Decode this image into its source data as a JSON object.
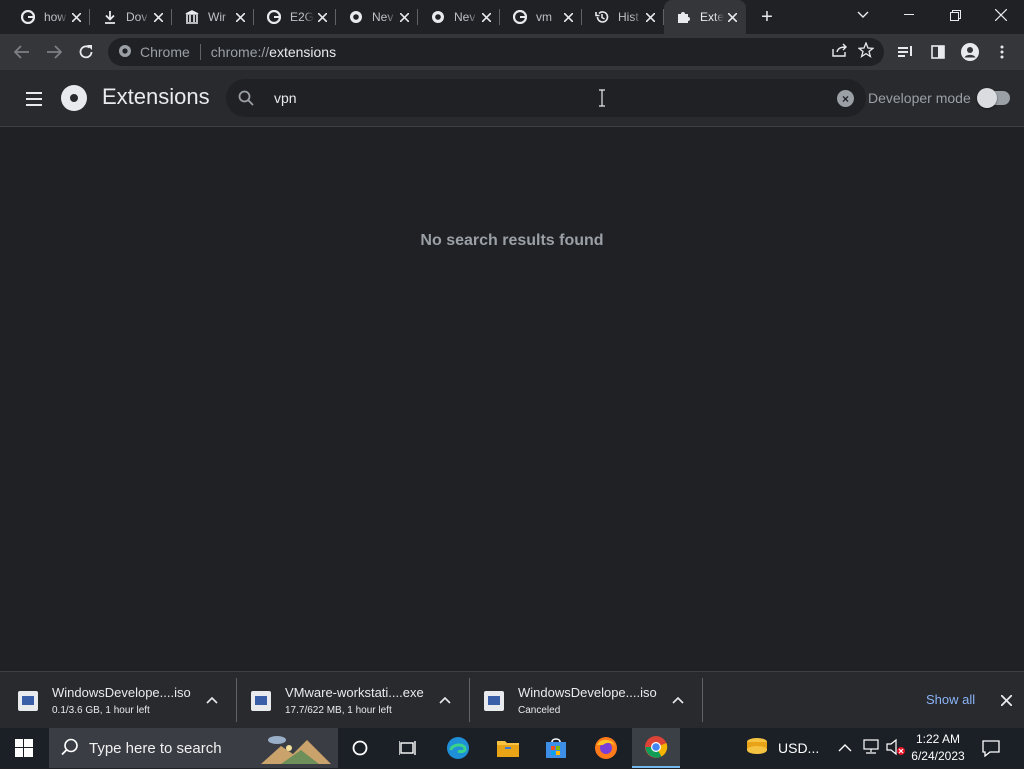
{
  "tabs": [
    {
      "title": "how",
      "icon": "google-icon",
      "active": false
    },
    {
      "title": "Dov",
      "icon": "download-icon",
      "active": false
    },
    {
      "title": "Wir",
      "icon": "museum-icon",
      "active": false
    },
    {
      "title": "E2G",
      "icon": "google-icon",
      "active": false
    },
    {
      "title": "Nev",
      "icon": "chrome-icon",
      "active": false
    },
    {
      "title": "Nev",
      "icon": "chrome-icon",
      "active": false
    },
    {
      "title": "vm",
      "icon": "google-icon",
      "active": false
    },
    {
      "title": "Hist",
      "icon": "history-icon",
      "active": false
    },
    {
      "title": "Exte",
      "icon": "puzzle-icon",
      "active": true
    }
  ],
  "omnibox": {
    "site_label": "Chrome",
    "scheme": "chrome://",
    "host": "extensions"
  },
  "extensions": {
    "title": "Extensions",
    "search_value": "vpn",
    "developer_mode_label": "Developer mode",
    "developer_mode_on": false,
    "no_results": "No search results found"
  },
  "downloads": [
    {
      "name": "WindowsDevelope....iso",
      "status": "0.1/3.6 GB, 1 hour left"
    },
    {
      "name": "VMware-workstati....exe",
      "status": "17.7/622 MB, 1 hour left"
    },
    {
      "name": "WindowsDevelope....iso",
      "status": "Canceled"
    }
  ],
  "shelf": {
    "show_all": "Show all"
  },
  "taskbar": {
    "search_placeholder": "Type here to search",
    "tray_label": "USD...",
    "time": "1:22 AM",
    "date": "6/24/2023"
  },
  "colors": {
    "accent_link": "#8ab4f8",
    "background": "#202124",
    "header": "#292a2d"
  }
}
